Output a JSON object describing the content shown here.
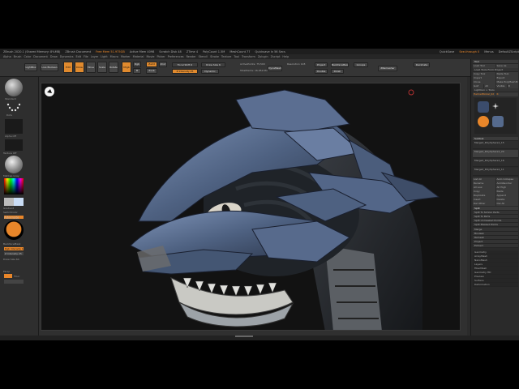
{
  "window": {
    "title_parts": [
      "ZBrush 2020.1 (Shared Memory: 8%MB)",
      "ZBrush Document",
      "Free Mem 51.975GB",
      "Active Mem 4098",
      "Scratch Disk 48",
      "ZTime 4",
      "PolyCount 1.5M",
      "MeshCount 77",
      "Quicksave In 56 Secs"
    ],
    "right_items": [
      "QuickSave",
      "See-through 0",
      "Menus",
      "DefaultZScript"
    ]
  },
  "menubar": [
    "Alpha",
    "Brush",
    "Color",
    "Document",
    "Draw",
    "Dynamics",
    "Edit",
    "File",
    "Layer",
    "Light",
    "Macro",
    "Marker",
    "Material",
    "Movie",
    "Picker",
    "Preferences",
    "Render",
    "Stencil",
    "Stroke",
    "Texture",
    "Tool",
    "Transform",
    "Zplugin",
    "Zscript",
    "Help"
  ],
  "toolbar": {
    "lightbox": "LightBox",
    "live_boolean": "Live Boolean",
    "edit": "Edit",
    "draw": "Draw",
    "move": "Move",
    "scale": "Scale",
    "rotate": "Rotate",
    "mrgb": "Mrgb",
    "rgb": "Rgb",
    "m": "M",
    "zadd": "Zadd",
    "zsub": "Zsub",
    "zcut": "Zcut",
    "focal_shift": "Focal Shift 0",
    "z_intensity": "Z Intensity 25",
    "draw_size": "Draw Size 6",
    "dynamic": "Dynamic",
    "active_points": "ActivePoints: 75,500",
    "total_points": "TotalPoints: 16.952 Mil",
    "dynamesh": "DynaMesh",
    "resolution": "Resolution 128",
    "project": "Project",
    "backface": "BackfaceMask",
    "double": "Double",
    "polish": "Polish",
    "groups": "Groups",
    "zremesher": "ZRemesher",
    "decimate": "Decimate"
  },
  "shelf": {
    "brush_label": "Standard",
    "stroke_label": "Dots",
    "alpha_label": "Alpha Off",
    "texture_label": "Texture Off",
    "material_label": "MatCap Gray",
    "gradient_label": "Gradient",
    "switch_color": "SwitchColor",
    "alternate": "Alternate",
    "backface_mask": "BackfaceMask",
    "rgb_intensity": "Rgb Intensity 100",
    "z_intensity": "Z Intensity 25",
    "draw_size": "Draw Size 64",
    "persp": "Persp",
    "floor": "Floor",
    "local": "Local",
    "xyz": "Xyz",
    "frame": "Frame",
    "move": "Move",
    "zoom3d": "Zoom3D",
    "rotate": "Rotate",
    "transp": "Transp",
    "solo": "Solo"
  },
  "tray": {
    "header": "Tool",
    "rows": [
      [
        "Load Tool",
        "Save As"
      ],
      [
        "Load Tools From Project"
      ],
      [
        "Copy Tool",
        "Paste Tool"
      ],
      [
        "Import",
        "Export"
      ],
      [
        "Clone",
        "Make PolyMesh3D"
      ],
      [
        "GoZ",
        "All",
        "Visible",
        "R"
      ],
      [
        "Lightbox > Tools"
      ],
      [
        "HelmetModel_02",
        "R"
      ]
    ],
    "subtool_header": "Subtool",
    "subtool_items": [
      "Merged_PolySphere1_15",
      "Merged_PolySphere1_20",
      "Merged_PolySphere1_16",
      "Merged_PolySphere1_11"
    ],
    "subtool_controls": [
      [
        "List All",
        "Auto Collapse"
      ],
      [
        "Rename",
        "AutoReorder"
      ],
      [
        "All Low",
        "All High"
      ],
      [
        "Copy",
        "Paste"
      ],
      [
        "Duplicate",
        "Append"
      ],
      [
        "Insert",
        "Delete"
      ],
      [
        "Del Other",
        "Del All"
      ],
      [
        "Split"
      ],
      [
        "Merge"
      ],
      [
        "Boolean"
      ],
      [
        "Remesh"
      ],
      [
        "Project"
      ],
      [
        "Extract"
      ]
    ],
    "split_items": [
      "Split To Similar Parts",
      "Split To Parts",
      "Split Unmasked Points",
      "Split Masked Points"
    ],
    "bottom_menus": [
      "Geometry",
      "ArrayMesh",
      "NanoMesh",
      "Layers",
      "FiberMesh",
      "Geometry HD",
      "Preview",
      "Surface",
      "Deformation"
    ]
  },
  "accent_color": "#e8862a",
  "model_colors": {
    "armor": "#4e6181",
    "armor_light": "#6f84a6",
    "teeth": "#c9c9c4",
    "cables": "#1f2328"
  }
}
